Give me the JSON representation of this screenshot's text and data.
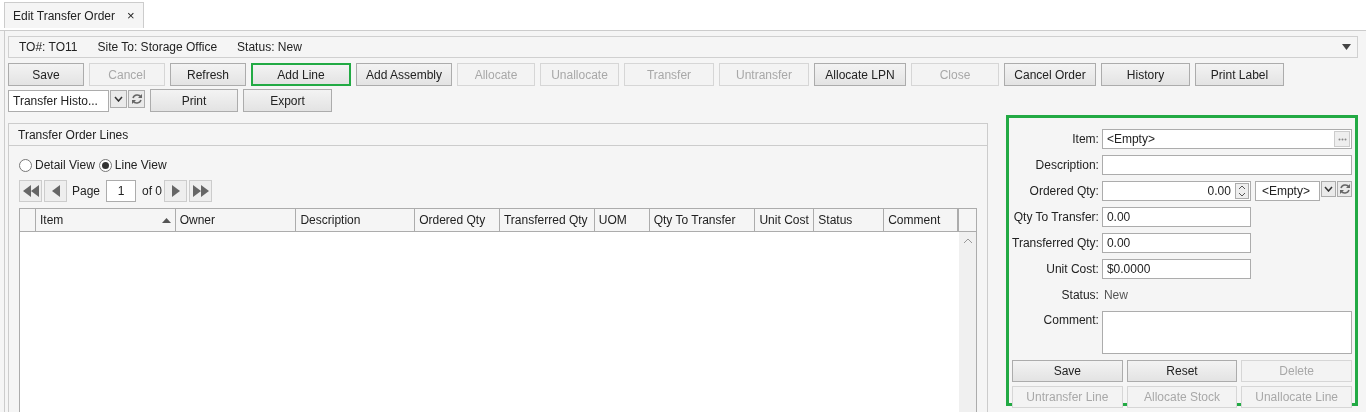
{
  "tabs": [
    {
      "label": "Edit Transfer Order",
      "close": "×",
      "selected": true
    }
  ],
  "header": {
    "fields": [
      "TO#: TO11",
      "Site To: Storage Office",
      "Status: New"
    ]
  },
  "toolbar": [
    {
      "label": "Save",
      "disabled": false,
      "highlighted": false
    },
    {
      "label": "Cancel",
      "disabled": true,
      "highlighted": false
    },
    {
      "label": "Refresh",
      "disabled": false,
      "highlighted": false
    },
    {
      "label": "Add Line",
      "disabled": false,
      "highlighted": true
    },
    {
      "label": "Add Assembly",
      "disabled": false,
      "highlighted": false
    },
    {
      "label": "Allocate",
      "disabled": true,
      "highlighted": false
    },
    {
      "label": "Unallocate",
      "disabled": true,
      "highlighted": false
    },
    {
      "label": "Transfer",
      "disabled": true,
      "highlighted": false
    },
    {
      "label": "Untransfer",
      "disabled": true,
      "highlighted": false
    },
    {
      "label": "Allocate LPN",
      "disabled": false,
      "highlighted": false
    },
    {
      "label": "Close",
      "disabled": true,
      "highlighted": false
    },
    {
      "label": "Cancel Order",
      "disabled": false,
      "highlighted": false
    },
    {
      "label": "History",
      "disabled": false,
      "highlighted": false
    },
    {
      "label": "Print Label",
      "disabled": false,
      "highlighted": false
    }
  ],
  "report_bar": {
    "report_select": {
      "value": "Transfer Histo..."
    },
    "buttons": [
      {
        "label": "Print",
        "disabled": false
      },
      {
        "label": "Export",
        "disabled": false
      }
    ]
  },
  "lines_panel": {
    "title": "Transfer Order Lines",
    "views": [
      {
        "label": "Detail View",
        "selected": false
      },
      {
        "label": "Line View",
        "selected": true
      }
    ],
    "pager": {
      "label": "Page",
      "page": "1",
      "of": "of 0"
    },
    "table": {
      "columns": [
        {
          "label": "Item",
          "sorted": true
        },
        {
          "label": "Owner",
          "sorted": false
        },
        {
          "label": "Description",
          "sorted": false
        },
        {
          "label": "Ordered Qty",
          "sorted": false
        },
        {
          "label": "Transferred Qty",
          "sorted": false
        },
        {
          "label": "UOM",
          "sorted": false
        },
        {
          "label": "Qty To Transfer",
          "sorted": false
        },
        {
          "label": "Unit Cost",
          "sorted": false
        },
        {
          "label": "Status",
          "sorted": false
        },
        {
          "label": "Comment",
          "sorted": false
        }
      ]
    }
  },
  "detail_panel": {
    "highlighted": true,
    "fields": [
      {
        "kind": "lookup",
        "label": "Item:",
        "value": "<Empty>"
      },
      {
        "kind": "text",
        "label": "Description:"
      },
      {
        "kind": "qty",
        "label": "Ordered Qty:",
        "value": "0.00",
        "unit": "<Empty>"
      },
      {
        "kind": "short",
        "label": "Qty To Transfer:",
        "value": "0.00"
      },
      {
        "kind": "short",
        "label": "Transferred Qty:",
        "value": "0.00"
      },
      {
        "kind": "short",
        "label": "Unit Cost:",
        "value": "$0.0000"
      },
      {
        "kind": "static",
        "label": "Status:",
        "value": "New"
      },
      {
        "kind": "memo",
        "label": "Comment:"
      }
    ],
    "buttons": [
      {
        "label": "Save",
        "disabled": false
      },
      {
        "label": "Reset",
        "disabled": false
      },
      {
        "label": "Delete",
        "disabled": true
      },
      {
        "label": "Untransfer Line",
        "disabled": true
      },
      {
        "label": "Allocate Stock",
        "disabled": true
      },
      {
        "label": "Unallocate Line",
        "disabled": true
      }
    ]
  }
}
